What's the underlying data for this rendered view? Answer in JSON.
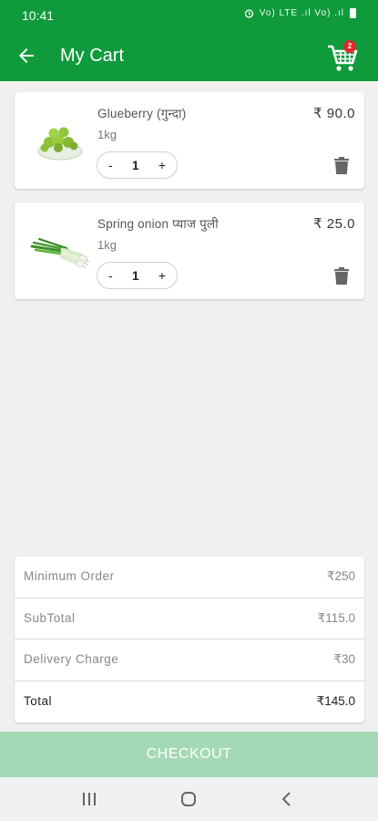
{
  "status_bar": {
    "time": "10:41",
    "signal_text": "Vo) LTE .ıl Vo) .ıl"
  },
  "app_bar": {
    "title": "My Cart",
    "cart_badge_count": "2"
  },
  "cart_items": [
    {
      "name": "Glueberry (गुन्दा)",
      "unit": "1kg",
      "price": "₹ 90.0",
      "quantity": "1",
      "decrement_label": "-",
      "increment_label": "+",
      "image": "glueberry-bowl"
    },
    {
      "name": "Spring onion प्याज पुली",
      "unit": "1kg",
      "price": "₹ 25.0",
      "quantity": "1",
      "decrement_label": "-",
      "increment_label": "+",
      "image": "spring-onion"
    }
  ],
  "summary": {
    "minimum_order": {
      "label": "Minimum Order",
      "value": "₹250"
    },
    "subtotal": {
      "label": "SubTotal",
      "value": "₹115.0"
    },
    "delivery_charge": {
      "label": "Delivery Charge",
      "value": "₹30"
    },
    "total": {
      "label": "Total",
      "value": "₹145.0"
    }
  },
  "checkout": {
    "label": "CHECKOUT"
  },
  "colors": {
    "primary_green": "#0f9a3c",
    "checkout_disabled_green": "#a5d8b6",
    "badge_red": "#e02a2a"
  },
  "icons": {
    "back": "arrow-left-icon",
    "cart": "shopping-cart-icon",
    "delete": "trash-icon",
    "nav_recents": "recents-icon",
    "nav_home": "home-icon",
    "nav_back": "nav-back-icon"
  }
}
